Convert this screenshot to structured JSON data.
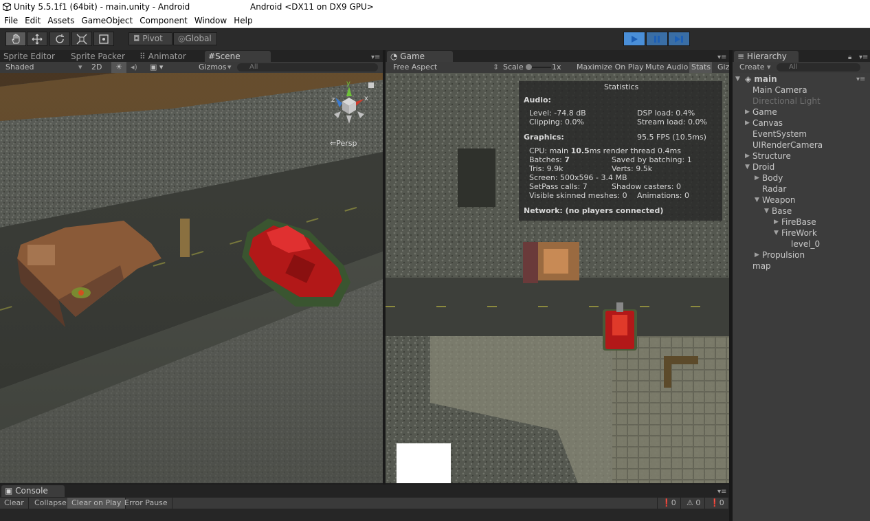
{
  "window": {
    "title_left": "Unity 5.5.1f1 (64bit) - main.unity - Android",
    "title_right": "Android <DX11 on DX9 GPU>"
  },
  "menu": [
    "File",
    "Edit",
    "Assets",
    "GameObject",
    "Component",
    "Window",
    "Help"
  ],
  "toolbar": {
    "pivot_label": "Pivot",
    "global_label": "Global"
  },
  "scene_panel": {
    "tabs": [
      "Sprite Editor",
      "Sprite Packer",
      "Animator",
      "Scene"
    ],
    "shading_mode": "Shaded",
    "mode_2d": "2D",
    "gizmos_label": "Gizmos",
    "search_placeholder": "All",
    "persp_label": "Persp",
    "gizmo_y": "y",
    "gizmo_x": "x",
    "gizmo_z": "z"
  },
  "game_panel": {
    "tab": "Game",
    "aspect": "Free Aspect",
    "scale_label": "Scale",
    "scale_value": "1x",
    "maximize_on_play": "Maximize On Play",
    "mute_audio": "Mute Audio",
    "stats_btn": "Stats",
    "gizmos_trunc": "Giz"
  },
  "stats": {
    "title": "Statistics",
    "audio_header": "Audio:",
    "level": "Level: -74.8 dB",
    "clipping": "Clipping: 0.0%",
    "dsp_load": "DSP load: 0.4%",
    "stream_load": "Stream load: 0.0%",
    "graphics_header": "Graphics:",
    "fps": "95.5 FPS (10.5ms)",
    "cpu_prefix": "CPU: main ",
    "cpu_main": "10.5",
    "cpu_suffix": "ms  render thread 0.4ms",
    "batches_prefix": "Batches: ",
    "batches": "7",
    "saved_batching": "Saved by batching: 1",
    "tris": "Tris: 9.9k",
    "verts": "Verts: 9.5k",
    "screen": "Screen: 500x596 - 3.4 MB",
    "setpass": "SetPass calls: 7",
    "shadow_casters": "Shadow casters: 0",
    "skinned": "Visible skinned meshes: 0",
    "animations": "Animations: 0",
    "network": "Network: (no players connected)"
  },
  "hierarchy": {
    "tab": "Hierarchy",
    "create": "Create",
    "search_placeholder": "All",
    "scene_name": "main",
    "items": [
      {
        "label": "Main Camera",
        "depth": 0,
        "arrow": "none",
        "dim": false
      },
      {
        "label": "Directional Light",
        "depth": 0,
        "arrow": "none",
        "dim": true
      },
      {
        "label": "Game",
        "depth": 0,
        "arrow": "right",
        "dim": false
      },
      {
        "label": "Canvas",
        "depth": 0,
        "arrow": "right",
        "dim": false
      },
      {
        "label": "EventSystem",
        "depth": 0,
        "arrow": "none",
        "dim": false
      },
      {
        "label": "UIRenderCamera",
        "depth": 0,
        "arrow": "none",
        "dim": false
      },
      {
        "label": "Structure",
        "depth": 0,
        "arrow": "right",
        "dim": false
      },
      {
        "label": "Droid",
        "depth": 0,
        "arrow": "down",
        "dim": false
      },
      {
        "label": "Body",
        "depth": 1,
        "arrow": "right",
        "dim": false
      },
      {
        "label": "Radar",
        "depth": 1,
        "arrow": "none",
        "dim": false
      },
      {
        "label": "Weapon",
        "depth": 1,
        "arrow": "down",
        "dim": false
      },
      {
        "label": "Base",
        "depth": 2,
        "arrow": "down",
        "dim": false
      },
      {
        "label": "FireBase",
        "depth": 3,
        "arrow": "right",
        "dim": false
      },
      {
        "label": "FireWork",
        "depth": 3,
        "arrow": "down",
        "dim": false
      },
      {
        "label": "level_0",
        "depth": 4,
        "arrow": "none",
        "dim": false
      },
      {
        "label": "Propulsion",
        "depth": 1,
        "arrow": "right",
        "dim": false
      },
      {
        "label": "map",
        "depth": 0,
        "arrow": "none",
        "dim": false
      }
    ]
  },
  "console": {
    "tab": "Console",
    "clear": "Clear",
    "collapse": "Collapse",
    "clear_on_play": "Clear on Play",
    "error_pause": "Error Pause",
    "errors": "0",
    "warnings": "0",
    "infos": "0"
  }
}
